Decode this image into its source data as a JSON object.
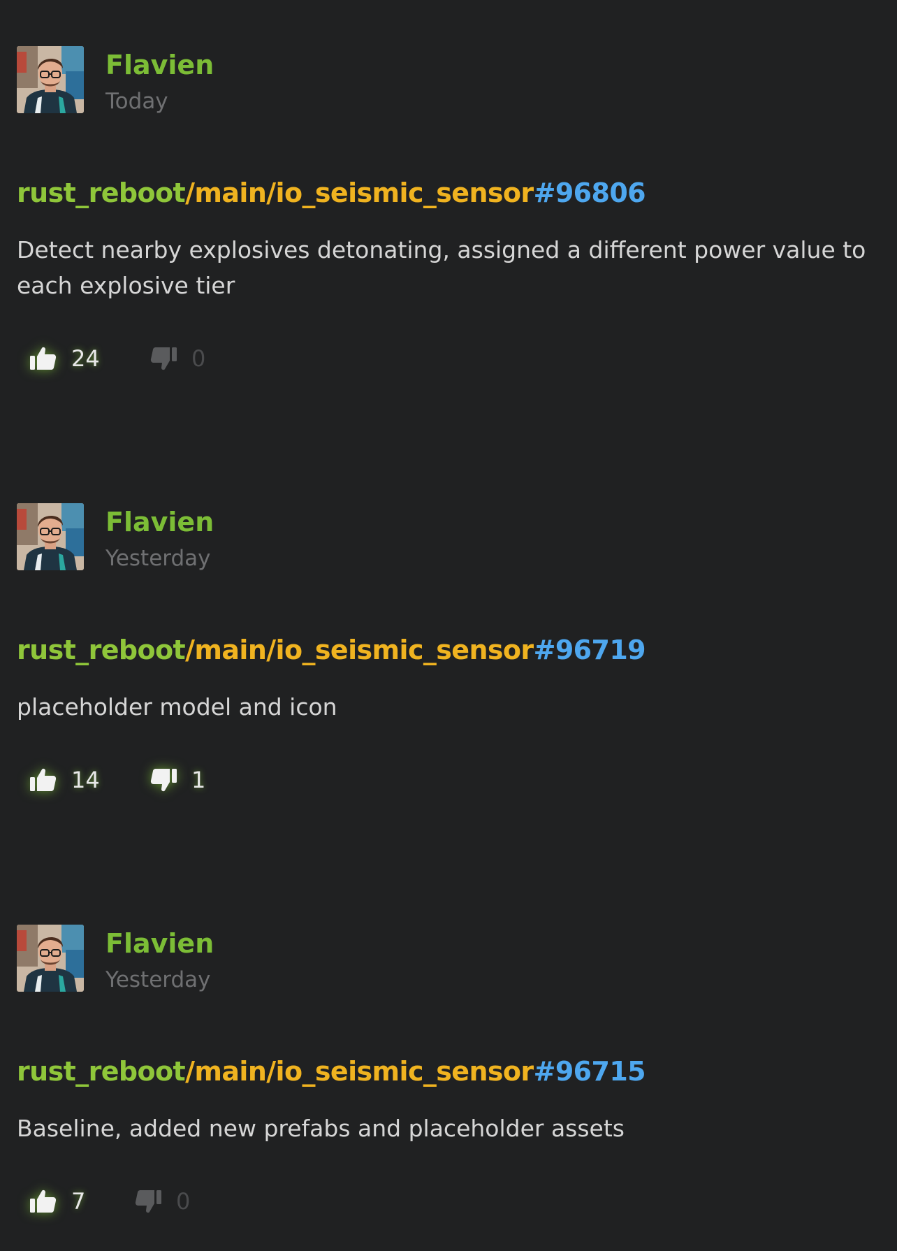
{
  "theme": {
    "background": "#202122",
    "author_color": "#7cbd36",
    "repo_color": "#8fc63a",
    "branch_color": "#f0b320",
    "change_color": "#4ea7ef",
    "active_icon": "#f2f2f2",
    "inactive_icon": "#5a5b5d"
  },
  "commits": [
    {
      "author": "Flavien",
      "date": "Today",
      "path_repo": "rust_reboot",
      "path_branch": "/main/io_seismic_sensor",
      "change": "#96806",
      "message": "Detect nearby explosives detonating, assigned a different power value to each explosive tier",
      "likes": "24",
      "dislikes": "0",
      "likes_active": true,
      "dislikes_active": false,
      "avatar_icon": "avatar-photo",
      "like_icon": "thumbs-up-icon",
      "dislike_icon": "thumbs-down-icon"
    },
    {
      "author": "Flavien",
      "date": "Yesterday",
      "path_repo": "rust_reboot",
      "path_branch": "/main/io_seismic_sensor",
      "change": "#96719",
      "message": "placeholder model and icon",
      "likes": "14",
      "dislikes": "1",
      "likes_active": true,
      "dislikes_active": true,
      "avatar_icon": "avatar-photo",
      "like_icon": "thumbs-up-icon",
      "dislike_icon": "thumbs-down-icon"
    },
    {
      "author": "Flavien",
      "date": "Yesterday",
      "path_repo": "rust_reboot",
      "path_branch": "/main/io_seismic_sensor",
      "change": "#96715",
      "message": "Baseline, added new prefabs and placeholder assets",
      "likes": "7",
      "dislikes": "0",
      "likes_active": true,
      "dislikes_active": false,
      "avatar_icon": "avatar-photo",
      "like_icon": "thumbs-up-icon",
      "dislike_icon": "thumbs-down-icon"
    }
  ]
}
